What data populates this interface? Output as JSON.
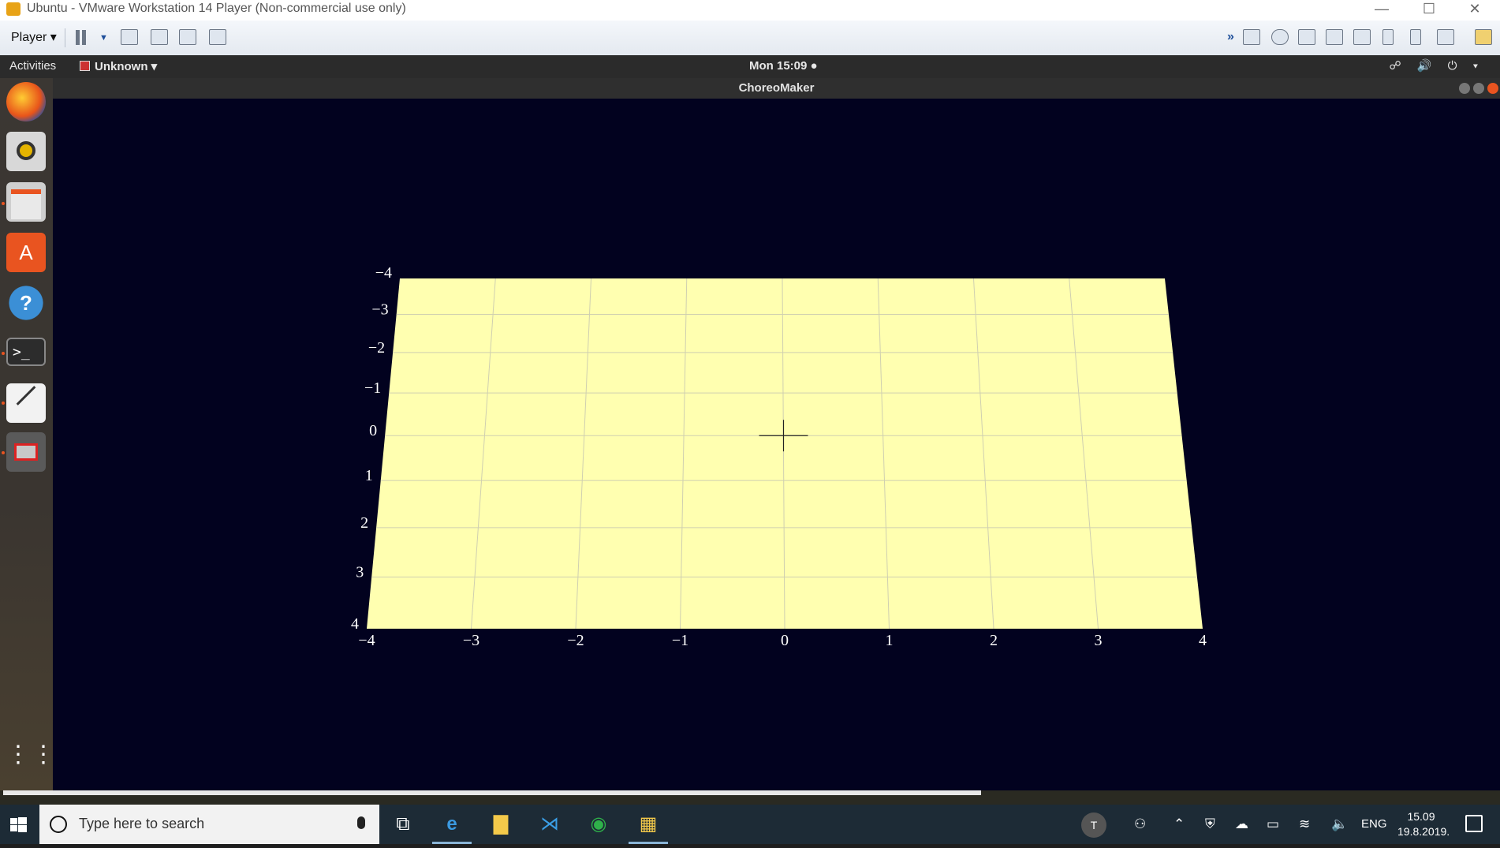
{
  "vmware": {
    "title": "Ubuntu - VMware Workstation 14 Player (Non-commercial use only)",
    "player_menu": "Player ▾"
  },
  "ubuntu": {
    "activities": "Activities",
    "app_menu": "Unknown ▾",
    "clock": "Mon 15:09 ●",
    "system_icons": "☍ 🔊 ⏻ ▾",
    "dock_items": [
      {
        "name": "firefox-icon"
      },
      {
        "name": "rhythmbox-icon"
      },
      {
        "name": "files-icon"
      },
      {
        "name": "software-center-icon"
      },
      {
        "name": "help-icon"
      },
      {
        "name": "terminal-icon"
      },
      {
        "name": "text-editor-icon"
      },
      {
        "name": "choreomaker-icon"
      },
      {
        "name": "show-applications-icon"
      }
    ]
  },
  "app_window": {
    "title": "ChoreoMaker"
  },
  "chart_data": {
    "type": "heatmap",
    "title": "",
    "x_ticks": [
      "−4",
      "−3",
      "−2",
      "−1",
      "0",
      "1",
      "2",
      "3",
      "4"
    ],
    "y_ticks": [
      "−4",
      "−3",
      "−2",
      "−1",
      "0",
      "1",
      "2",
      "3",
      "4"
    ],
    "xlim": [
      -4,
      4
    ],
    "ylim": [
      -4,
      4
    ],
    "grid": true,
    "surface_color": "#ffffb0",
    "background_color": "#02021f",
    "perspective": "floor plane viewed in perspective, far edge at y = −4",
    "cursor_marker": "crosshair at (0, 0)"
  },
  "taskbar": {
    "search_placeholder": "Type here to search",
    "language": "ENG",
    "time": "15.09",
    "date": "19.8.2019.",
    "avatar_letter": "T"
  }
}
